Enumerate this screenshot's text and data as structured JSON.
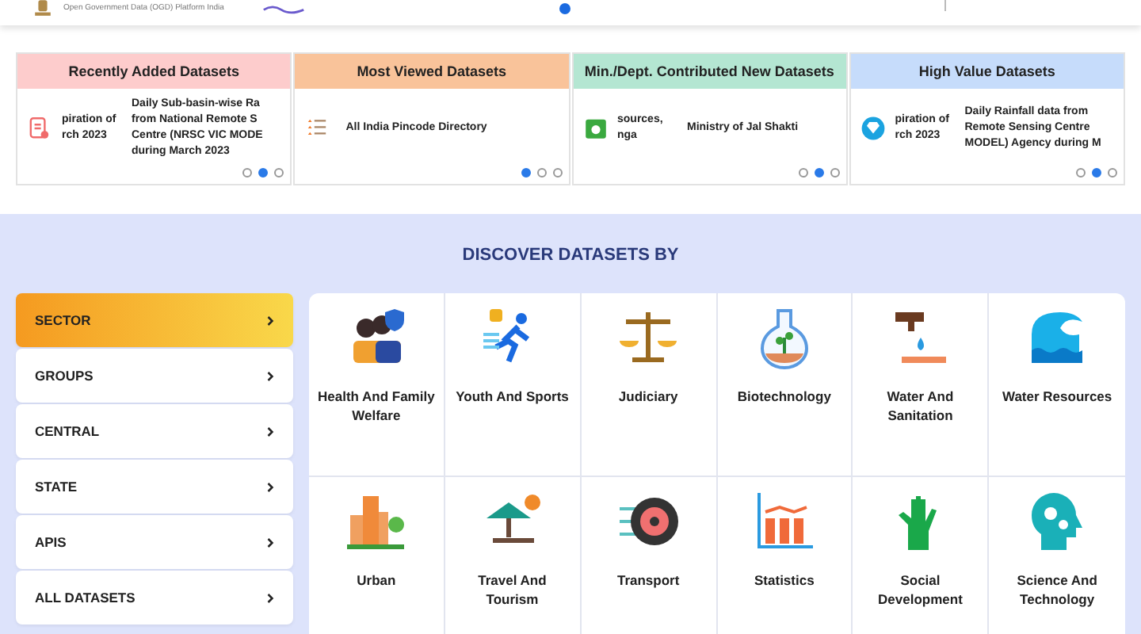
{
  "header": {
    "platform_name": "Open Government Data (OGD) Platform India"
  },
  "highlights": [
    {
      "title": "Recently Added Datasets",
      "color": "#fdcccc",
      "col_1": [
        "piration of",
        "rch 2023"
      ],
      "col_2": [
        "Daily Sub-basin-wise Ra",
        "from National Remote S",
        "Centre (NRSC VIC MODE",
        "during March 2023"
      ],
      "dots": [
        {
          "selected": false
        },
        {
          "selected": true
        },
        {
          "selected": false
        }
      ]
    },
    {
      "title": "Most Viewed Datasets",
      "color": "#f9c39a",
      "col_2": [
        "All India Pincode Directory"
      ],
      "dots": [
        {
          "selected": true
        },
        {
          "selected": false
        },
        {
          "selected": false
        }
      ]
    },
    {
      "title": "Min./Dept. Contributed New Datasets",
      "color": "#b4e6d2",
      "col_1": [
        "sources,",
        "nga"
      ],
      "col_2": [
        "Ministry of Jal Shakti"
      ],
      "dots": [
        {
          "selected": false
        },
        {
          "selected": true
        },
        {
          "selected": false
        }
      ]
    },
    {
      "title": "High Value Datasets",
      "color": "#c6dcfb",
      "col_1": [
        "piration of",
        "rch 2023"
      ],
      "col_2": [
        "Daily Rainfall data from",
        "Remote Sensing Centre",
        "MODEL) Agency during M"
      ],
      "dots": [
        {
          "selected": false
        },
        {
          "selected": true
        },
        {
          "selected": false
        }
      ]
    }
  ],
  "discover": {
    "title": "DISCOVER DATASETS BY",
    "menu": [
      {
        "label": "SECTOR",
        "selected": true
      },
      {
        "label": "GROUPS",
        "selected": false
      },
      {
        "label": "CENTRAL",
        "selected": false
      },
      {
        "label": "STATE",
        "selected": false
      },
      {
        "label": "APIS",
        "selected": false
      },
      {
        "label": "ALL DATASETS",
        "selected": false
      }
    ],
    "sectors": [
      {
        "label": "Health And Family Welfare"
      },
      {
        "label": "Youth And Sports"
      },
      {
        "label": "Judiciary"
      },
      {
        "label": "Biotechnology"
      },
      {
        "label": "Water And Sanitation"
      },
      {
        "label": "Water Resources"
      },
      {
        "label": "Urban"
      },
      {
        "label": "Travel And Tourism"
      },
      {
        "label": "Transport"
      },
      {
        "label": "Statistics"
      },
      {
        "label": "Social Development"
      },
      {
        "label": "Science And Technology"
      }
    ]
  }
}
